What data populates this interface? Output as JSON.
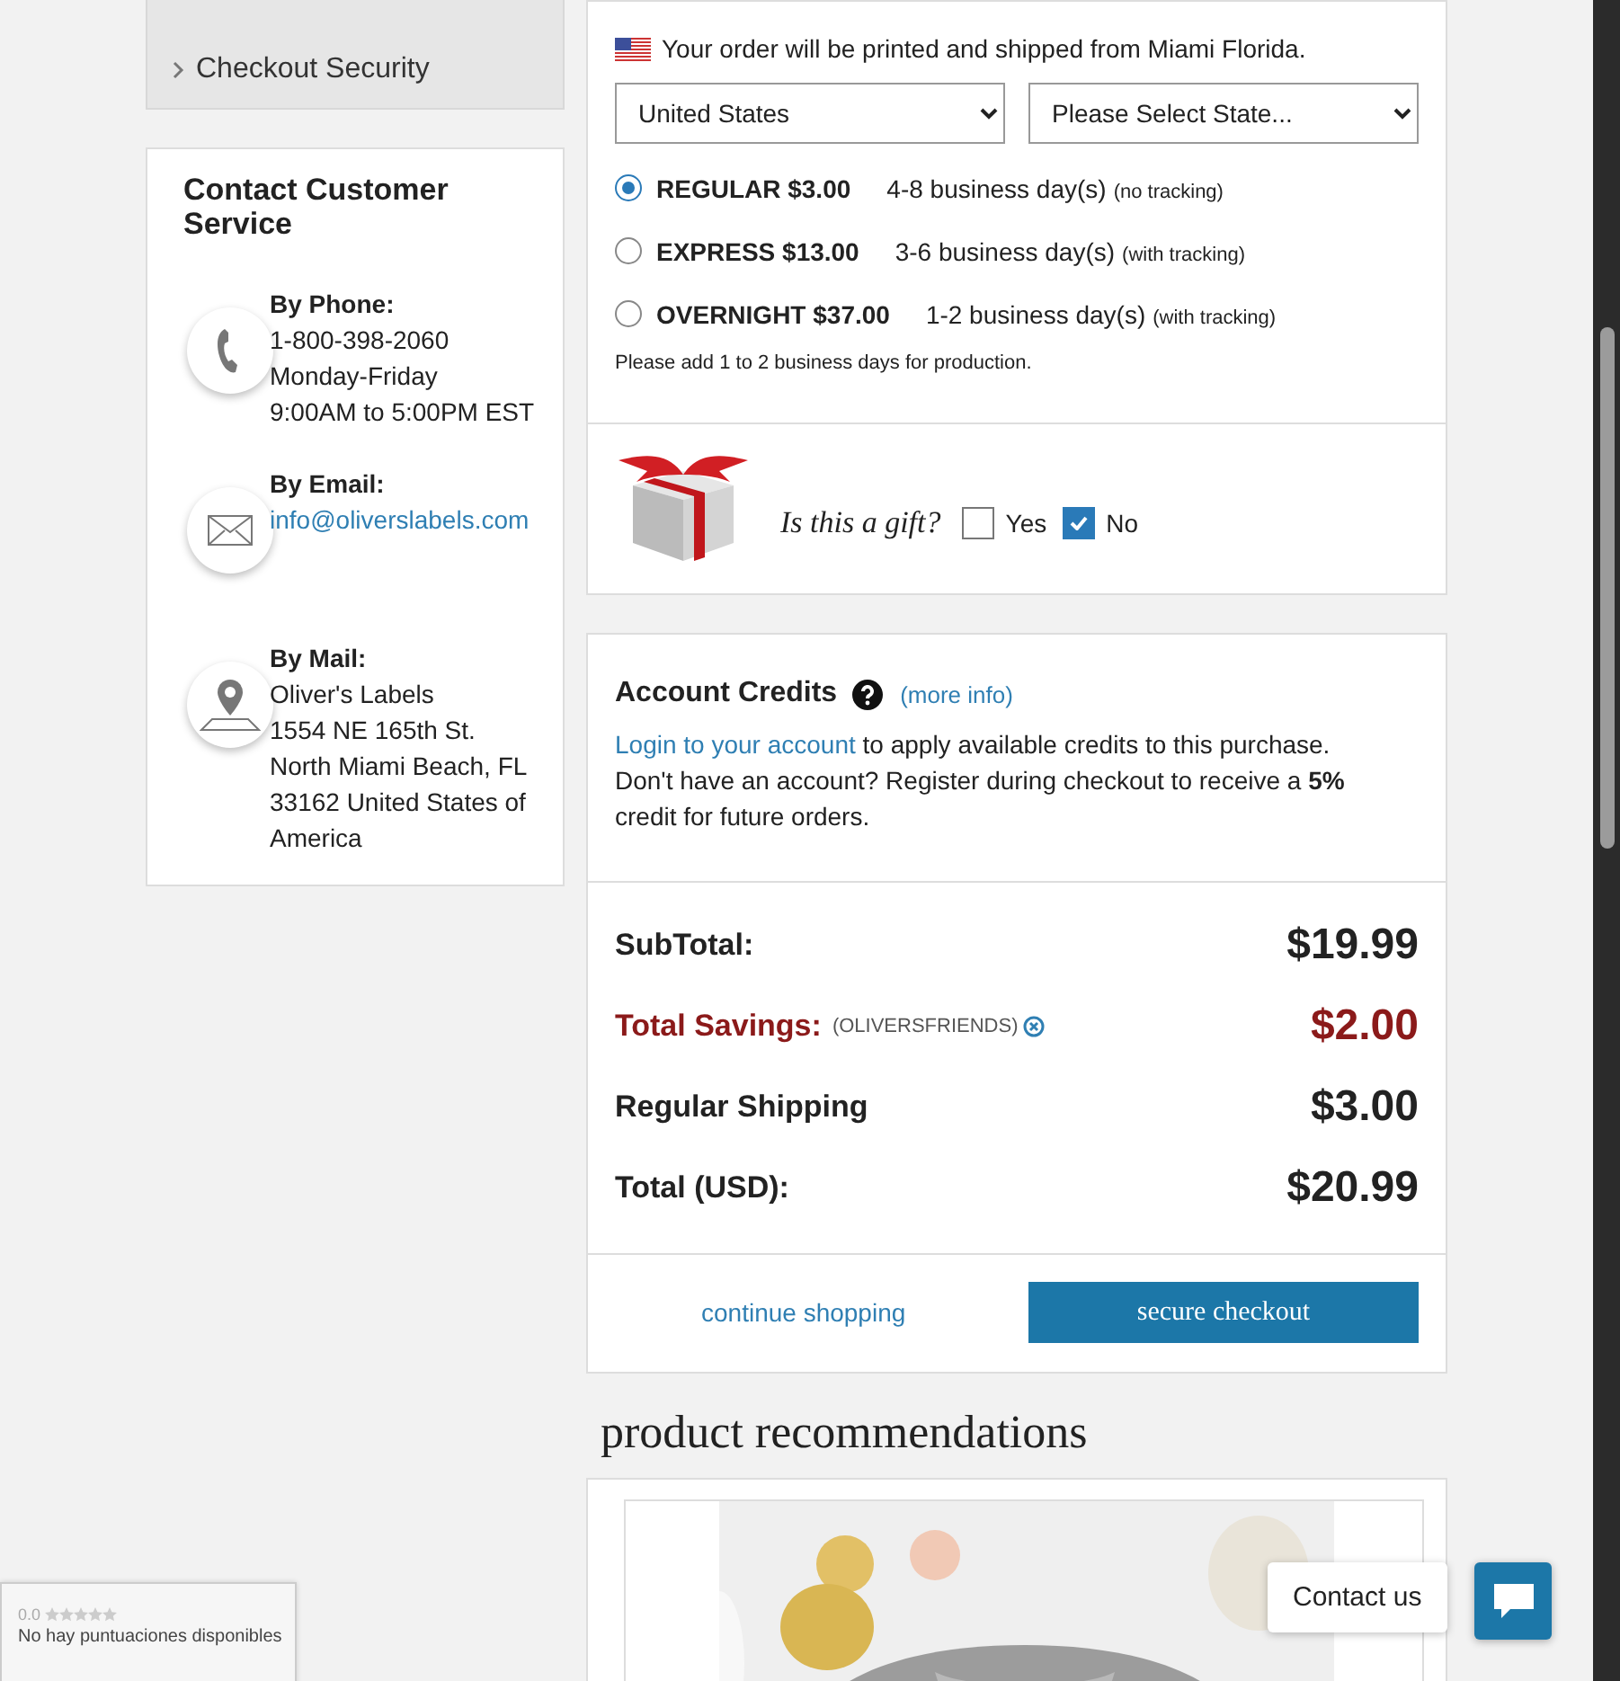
{
  "nav": {
    "items": [
      {
        "label": "Checkout Security"
      }
    ]
  },
  "contact": {
    "title": "Contact Customer Service",
    "methods": [
      {
        "kind": "phone",
        "label": "By Phone:",
        "lines": [
          "1-800-398-2060",
          "Monday-Friday",
          "9:00AM to 5:00PM EST"
        ]
      },
      {
        "kind": "email",
        "label": "By Email:",
        "link": "info@oliverslabels.com"
      },
      {
        "kind": "mail",
        "label": "By Mail:",
        "lines": [
          "Oliver's Labels",
          "1554 NE 165th St.",
          "North Miami Beach, FL",
          "33162 United States of America"
        ]
      }
    ]
  },
  "shipping": {
    "origin": "Your order will be printed and shipped from Miami Florida.",
    "country": "United States",
    "state": "Please Select State...",
    "options": [
      {
        "name": "REGULAR $3.00",
        "days": "4-8 business day(s)",
        "note": "(no tracking)",
        "selected": true
      },
      {
        "name": "EXPRESS $13.00",
        "days": "3-6 business day(s)",
        "note": "(with tracking)",
        "selected": false
      },
      {
        "name": "OVERNIGHT $37.00",
        "days": "1-2 business day(s)",
        "note": "(with tracking)",
        "selected": false
      }
    ],
    "production_note": "Please add 1 to 2 business days for production."
  },
  "gift": {
    "question": "Is this a gift?",
    "choices": [
      {
        "label": "Yes",
        "checked": false
      },
      {
        "label": "No",
        "checked": true
      }
    ]
  },
  "credits": {
    "title": "Account Credits",
    "more_info": "(more info)",
    "login_link": "Login to your account",
    "text": " to apply available credits to this purchase. Don't have an account? Register during checkout to receive a **5%** credit for future orders."
  },
  "totals": [
    {
      "kind": "plain",
      "label": "SubTotal:",
      "value": "$19.99"
    },
    {
      "kind": "savings",
      "label": "Total Savings:",
      "code": "(OLIVERSFRIENDS)",
      "value": "$2.00"
    },
    {
      "kind": "plain",
      "label": "Regular Shipping",
      "value": "$3.00"
    },
    {
      "kind": "plain",
      "label": "Total (USD):",
      "value": "$20.99"
    }
  ],
  "actions": {
    "continue": "continue shopping",
    "checkout": "secure checkout"
  },
  "recommendations": {
    "title": "product recommendations"
  },
  "rating_badge": {
    "score": "0.0",
    "stars": 0,
    "text": "No hay puntuaciones disponibles"
  },
  "chat": {
    "label": "Contact us"
  }
}
